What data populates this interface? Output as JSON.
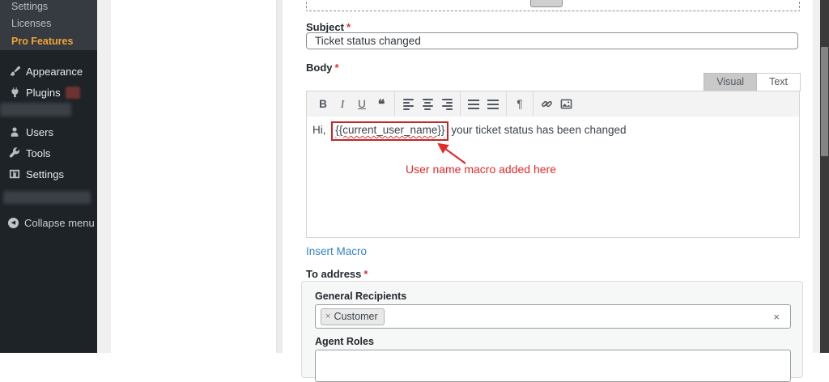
{
  "sidebar": {
    "submenu": {
      "items": [
        {
          "label": "Settings"
        },
        {
          "label": "Licenses"
        },
        {
          "label": "Pro Features"
        }
      ]
    },
    "menu": [
      {
        "label": "Appearance",
        "icon": "brush-icon"
      },
      {
        "label": "Plugins",
        "icon": "plugin-icon",
        "badge": true
      },
      {
        "label": "Users",
        "icon": "users-icon"
      },
      {
        "label": "Tools",
        "icon": "wrench-icon"
      },
      {
        "label": "Settings",
        "icon": "sliders-icon"
      }
    ],
    "collapse_label": "Collapse menu"
  },
  "form": {
    "subject": {
      "label": "Subject",
      "required": "*",
      "value": "Ticket status changed"
    },
    "body": {
      "label": "Body",
      "required": "*",
      "tabs": [
        {
          "label": "Visual",
          "active": true
        },
        {
          "label": "Text",
          "active": false
        }
      ]
    },
    "insert_macro_label": "Insert Macro",
    "to_address": {
      "label": "To address",
      "required": "*",
      "general_recipients": {
        "label": "General Recipients",
        "chips": [
          {
            "label": "Customer",
            "remove_glyph": "×"
          }
        ],
        "clear_glyph": "×"
      },
      "agent_roles": {
        "label": "Agent Roles"
      }
    }
  },
  "editor": {
    "toolbar": {
      "bold_glyph": "B",
      "italic_glyph": "I",
      "underline_glyph": "U",
      "blockquote_glyph": "❝",
      "paragraph_glyph": "¶"
    },
    "content": {
      "prefix": "Hi, ",
      "macro": "{{current_user_name}}",
      "suffix": "your ticket status has been changed"
    },
    "annotation": "User name macro added here"
  },
  "colors": {
    "pro_features_orange": "#f0a431",
    "annotation_red": "#e02b2b",
    "link_blue": "#3582c4",
    "required_red": "#d63638",
    "sidebar_bg": "#1d2327",
    "active_tab_gray": "#c9c9c9"
  }
}
